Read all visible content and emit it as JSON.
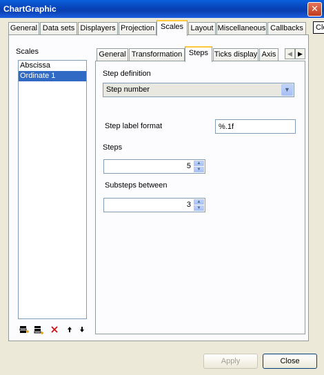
{
  "window": {
    "title": "ChartGraphic",
    "close_glyph": "✕"
  },
  "outer_tabs": [
    {
      "label": "General"
    },
    {
      "label": "Data sets"
    },
    {
      "label": "Displayers"
    },
    {
      "label": "Projection"
    },
    {
      "label": "Scales",
      "active": true
    },
    {
      "label": "Layout"
    },
    {
      "label": "Miscellaneous"
    },
    {
      "label": "Callbacks"
    }
  ],
  "clipped_label": "Clo",
  "scales": {
    "label": "Scales",
    "items": [
      "Abscissa",
      "Ordinate 1"
    ],
    "selected_index": 1,
    "toolbar": [
      "add-scale-icon",
      "add-scale-alt-icon",
      "delete-icon",
      "move-up-icon",
      "move-down-icon"
    ]
  },
  "inner_tabs": [
    {
      "label": "General"
    },
    {
      "label": "Transformation"
    },
    {
      "label": "Steps",
      "active": true
    },
    {
      "label": "Ticks display"
    },
    {
      "label": "Axis"
    }
  ],
  "steps": {
    "step_definition_label": "Step definition",
    "step_definition_value": "Step number",
    "step_label_format_label": "Step label format",
    "step_label_format_value": "%.1f",
    "steps_label": "Steps",
    "steps_value": "5",
    "substeps_label": "Substeps between",
    "substeps_value": "3"
  },
  "buttons": {
    "apply": "Apply",
    "close": "Close"
  },
  "colors": {
    "titlebar": "#0843b8",
    "selection": "#316ac5",
    "tab_highlight": "#ffc73c"
  }
}
